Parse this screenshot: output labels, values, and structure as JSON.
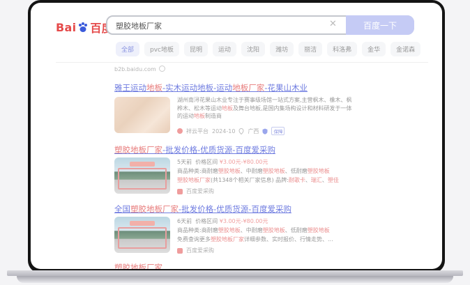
{
  "logo": {
    "left": "Bai",
    "right": "百度"
  },
  "search": {
    "query": "塑胶地板厂家",
    "button": "百度一下"
  },
  "tabs": [
    "全部",
    "pvc地板",
    "昆明",
    "运动",
    "沈阳",
    "潍坊",
    "丽洁",
    "科洛弗",
    "金华",
    "金诺森"
  ],
  "source": "b2b.baidu.com",
  "results": [
    {
      "title_parts": [
        "雅王运动",
        "地板",
        "-实木运动地板-运动",
        "地板厂家",
        "-花果山木业"
      ],
      "desc_parts": [
        "湖州南浔花果山木业专注于赛事级场馆一站式方案,主营枫木、橡木、枫",
        "桦木、松木等运动",
        "地板",
        "及舞台地板,是国内集场构设计和材料研发于一体",
        "的运动",
        "地板",
        "制造商"
      ],
      "meta": {
        "platform": "祥云平台",
        "date": "2024-10",
        "region": "广西",
        "badge": "保障"
      }
    },
    {
      "title_parts": [
        "塑胶地板厂家",
        "-批发价格-优质货源-百度爱采购"
      ],
      "days": "5天前",
      "price_label": "价格区间",
      "price": "¥3.00元-¥80.00元",
      "line1_parts": [
        "商品种类:商耐磨",
        "塑胶地板",
        "、中耐磨",
        "塑胶地板",
        "、低耐磨",
        "塑胶地板"
      ],
      "line2_parts": [
        "塑胶地板厂家",
        "(共1348个相关厂家信息) 品牌:",
        "耐歌卡",
        "、",
        "瑞汇",
        "、",
        "塑佳"
      ],
      "source": "百度爱采购"
    },
    {
      "title_parts": [
        "全国",
        "塑胶地板厂家",
        "-批发价格-优质货源-百度爱采购"
      ],
      "days": "6天前",
      "price_label": "价格区间",
      "price": "¥3.00元-¥80.00元",
      "line1_parts": [
        "商品种类:商耐磨",
        "塑胶地板",
        "、中耐磨",
        "塑胶地板",
        "、低耐磨",
        "塑胶地板"
      ],
      "line2_parts": [
        "免费查询更多",
        "塑胶地板厂家",
        "详细参数、实时报价、行情走势、..."
      ],
      "source": "百度爱采购"
    },
    {
      "title_parts": [
        "塑胶地板厂家"
      ]
    }
  ]
}
